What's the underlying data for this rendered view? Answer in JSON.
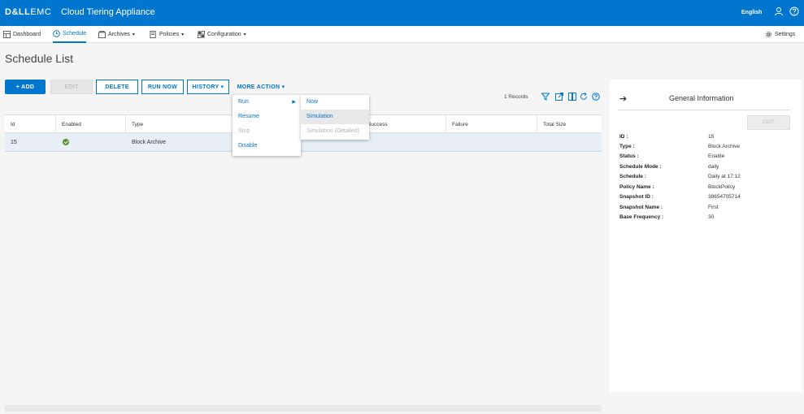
{
  "header": {
    "brand_bold": "D&LL",
    "brand_light": "EMC",
    "app_title": "Cloud Tiering Appliance",
    "language": "English",
    "colors": {
      "header_bg": "#0076ce",
      "accent": "#0076ce",
      "success": "#5a8f2e"
    }
  },
  "nav": {
    "dashboard": "Dashboard",
    "schedule": "Schedule",
    "archives": "Archives",
    "policies": "Policies",
    "configuration": "Configuration",
    "settings": "Settings",
    "caret": "▾"
  },
  "page": {
    "title": "Schedule List"
  },
  "toolbar": {
    "add": "+ ADD",
    "edit": "EDIT",
    "delete": "DELETE",
    "run_now": "RUN NOW",
    "history": "HISTORY ▾",
    "more_action": "MORE ACTION ▾",
    "records": "1 Records"
  },
  "table": {
    "columns": [
      "Id",
      "Enabled",
      "Type",
      "Success",
      "Failure",
      "Total Size"
    ],
    "rows": [
      {
        "id": "15",
        "enabled": true,
        "type": "Block Archive"
      }
    ]
  },
  "more_action_menu": {
    "items": [
      "Run",
      "Resume",
      "Stop",
      "Disable"
    ],
    "submenu_arrow": "▶"
  },
  "run_submenu": {
    "items": [
      "Now",
      "Simulation",
      "Simulation (Detailed)"
    ]
  },
  "panel": {
    "title": "General Information",
    "edit": "EDIT",
    "arrow": "➔",
    "fields": [
      {
        "label": "ID :",
        "value": "15"
      },
      {
        "label": "Type :",
        "value": "Block Archive"
      },
      {
        "label": "Status :",
        "value": "Enable"
      },
      {
        "label": "Schedule Mode :",
        "value": "daily"
      },
      {
        "label": "Schedule :",
        "value": "Daily at 17:12"
      },
      {
        "label": "Policy Name :",
        "value": "BlockPolicy"
      },
      {
        "label": "Snapshot ID :",
        "value": "38654705714"
      },
      {
        "label": "Snapshot Name :",
        "value": "First"
      },
      {
        "label": "Base Frequency :",
        "value": "30"
      }
    ]
  }
}
